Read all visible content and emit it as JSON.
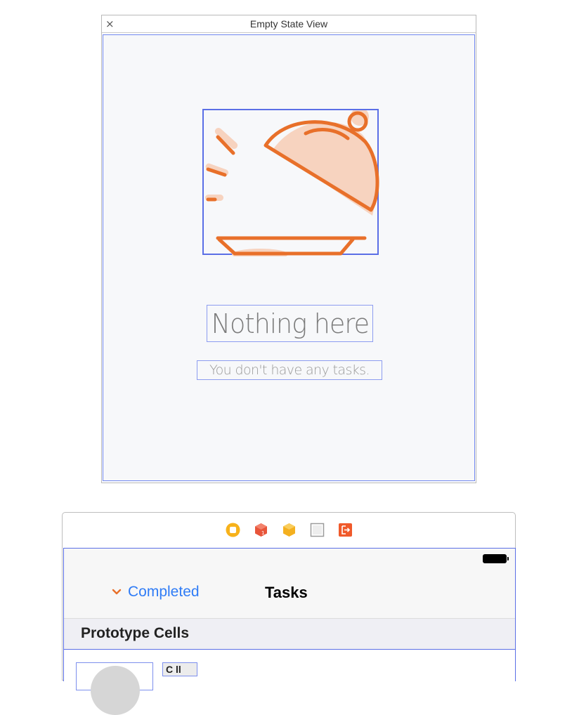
{
  "empty_state_panel": {
    "title": "Empty State View",
    "close_glyph": "×",
    "illustration_icon": "serving-dish-icon",
    "headline": "Nothing here",
    "subline": "You don't have any tasks."
  },
  "scene_dock": {
    "icons": [
      "view-controller-icon",
      "first-responder-icon",
      "object-icon",
      "view-placeholder-icon",
      "exit-icon"
    ]
  },
  "nav_bar": {
    "back_label": "Completed",
    "back_chevron": "chevron-down-icon",
    "title": "Tasks"
  },
  "table": {
    "section_header": "Prototype Cells",
    "cell_label_fragment": "C ll"
  },
  "colors": {
    "accent_orange": "#e8702a",
    "selection_blue": "#5b6fe6",
    "ios_tint": "#2f7cf6"
  }
}
